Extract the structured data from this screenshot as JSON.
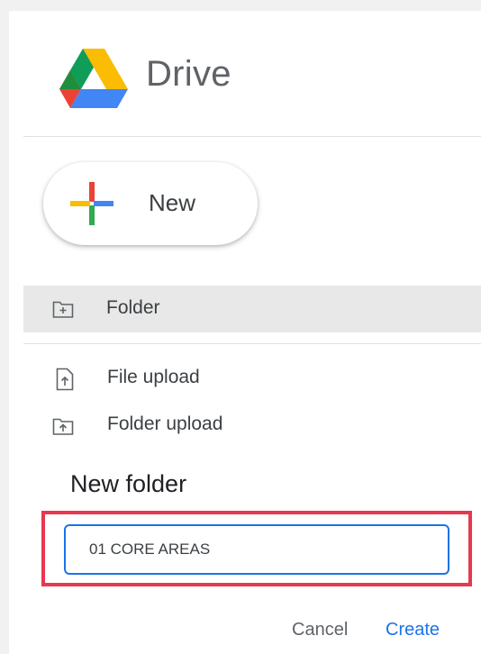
{
  "app": {
    "title": "Drive"
  },
  "new_button": {
    "label": "New"
  },
  "menu": {
    "items": [
      {
        "label": "Folder",
        "icon": "new-folder-icon",
        "highlighted": true
      },
      {
        "label": "File upload",
        "icon": "file-upload-icon"
      },
      {
        "label": "Folder upload",
        "icon": "folder-upload-icon"
      }
    ]
  },
  "dialog": {
    "title": "New folder",
    "input_value": "01 CORE AREAS",
    "cancel_label": "Cancel",
    "create_label": "Create"
  },
  "colors": {
    "accent": "#1a73e8",
    "highlight_border": "#e8384f",
    "menu_hover": "#e8e8e8",
    "logo_green": "#0f9d58",
    "logo_yellow": "#fbbc04",
    "logo_blue": "#4285f4",
    "logo_red": "#ea4335"
  }
}
